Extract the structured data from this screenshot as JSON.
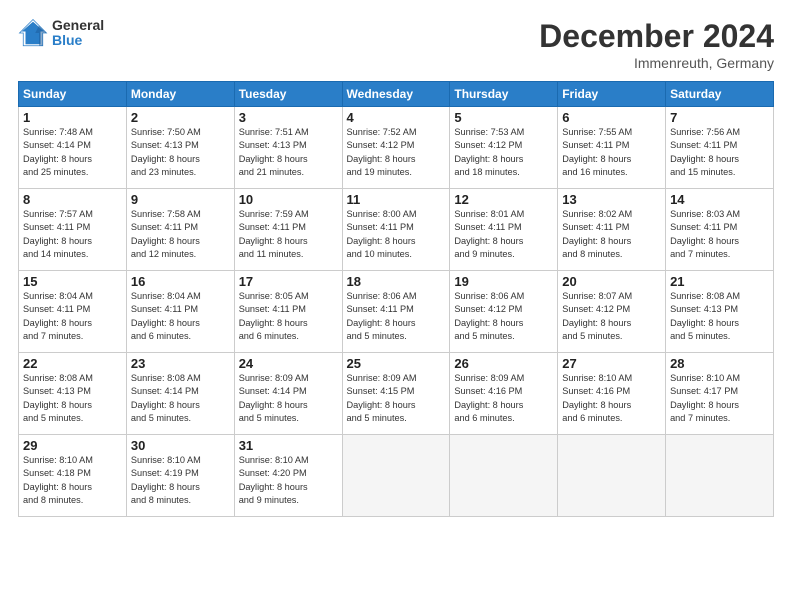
{
  "header": {
    "logo_general": "General",
    "logo_blue": "Blue",
    "month_title": "December 2024",
    "location": "Immenreuth, Germany"
  },
  "weekdays": [
    "Sunday",
    "Monday",
    "Tuesday",
    "Wednesday",
    "Thursday",
    "Friday",
    "Saturday"
  ],
  "weeks": [
    [
      {
        "day": "1",
        "sunrise": "7:48 AM",
        "sunset": "4:14 PM",
        "daylight": "8 hours and 25 minutes."
      },
      {
        "day": "2",
        "sunrise": "7:50 AM",
        "sunset": "4:13 PM",
        "daylight": "8 hours and 23 minutes."
      },
      {
        "day": "3",
        "sunrise": "7:51 AM",
        "sunset": "4:13 PM",
        "daylight": "8 hours and 21 minutes."
      },
      {
        "day": "4",
        "sunrise": "7:52 AM",
        "sunset": "4:12 PM",
        "daylight": "8 hours and 19 minutes."
      },
      {
        "day": "5",
        "sunrise": "7:53 AM",
        "sunset": "4:12 PM",
        "daylight": "8 hours and 18 minutes."
      },
      {
        "day": "6",
        "sunrise": "7:55 AM",
        "sunset": "4:11 PM",
        "daylight": "8 hours and 16 minutes."
      },
      {
        "day": "7",
        "sunrise": "7:56 AM",
        "sunset": "4:11 PM",
        "daylight": "8 hours and 15 minutes."
      }
    ],
    [
      {
        "day": "8",
        "sunrise": "7:57 AM",
        "sunset": "4:11 PM",
        "daylight": "8 hours and 14 minutes."
      },
      {
        "day": "9",
        "sunrise": "7:58 AM",
        "sunset": "4:11 PM",
        "daylight": "8 hours and 12 minutes."
      },
      {
        "day": "10",
        "sunrise": "7:59 AM",
        "sunset": "4:11 PM",
        "daylight": "8 hours and 11 minutes."
      },
      {
        "day": "11",
        "sunrise": "8:00 AM",
        "sunset": "4:11 PM",
        "daylight": "8 hours and 10 minutes."
      },
      {
        "day": "12",
        "sunrise": "8:01 AM",
        "sunset": "4:11 PM",
        "daylight": "8 hours and 9 minutes."
      },
      {
        "day": "13",
        "sunrise": "8:02 AM",
        "sunset": "4:11 PM",
        "daylight": "8 hours and 8 minutes."
      },
      {
        "day": "14",
        "sunrise": "8:03 AM",
        "sunset": "4:11 PM",
        "daylight": "8 hours and 7 minutes."
      }
    ],
    [
      {
        "day": "15",
        "sunrise": "8:04 AM",
        "sunset": "4:11 PM",
        "daylight": "8 hours and 7 minutes."
      },
      {
        "day": "16",
        "sunrise": "8:04 AM",
        "sunset": "4:11 PM",
        "daylight": "8 hours and 6 minutes."
      },
      {
        "day": "17",
        "sunrise": "8:05 AM",
        "sunset": "4:11 PM",
        "daylight": "8 hours and 6 minutes."
      },
      {
        "day": "18",
        "sunrise": "8:06 AM",
        "sunset": "4:11 PM",
        "daylight": "8 hours and 5 minutes."
      },
      {
        "day": "19",
        "sunrise": "8:06 AM",
        "sunset": "4:12 PM",
        "daylight": "8 hours and 5 minutes."
      },
      {
        "day": "20",
        "sunrise": "8:07 AM",
        "sunset": "4:12 PM",
        "daylight": "8 hours and 5 minutes."
      },
      {
        "day": "21",
        "sunrise": "8:08 AM",
        "sunset": "4:13 PM",
        "daylight": "8 hours and 5 minutes."
      }
    ],
    [
      {
        "day": "22",
        "sunrise": "8:08 AM",
        "sunset": "4:13 PM",
        "daylight": "8 hours and 5 minutes."
      },
      {
        "day": "23",
        "sunrise": "8:08 AM",
        "sunset": "4:14 PM",
        "daylight": "8 hours and 5 minutes."
      },
      {
        "day": "24",
        "sunrise": "8:09 AM",
        "sunset": "4:14 PM",
        "daylight": "8 hours and 5 minutes."
      },
      {
        "day": "25",
        "sunrise": "8:09 AM",
        "sunset": "4:15 PM",
        "daylight": "8 hours and 5 minutes."
      },
      {
        "day": "26",
        "sunrise": "8:09 AM",
        "sunset": "4:16 PM",
        "daylight": "8 hours and 6 minutes."
      },
      {
        "day": "27",
        "sunrise": "8:10 AM",
        "sunset": "4:16 PM",
        "daylight": "8 hours and 6 minutes."
      },
      {
        "day": "28",
        "sunrise": "8:10 AM",
        "sunset": "4:17 PM",
        "daylight": "8 hours and 7 minutes."
      }
    ],
    [
      {
        "day": "29",
        "sunrise": "8:10 AM",
        "sunset": "4:18 PM",
        "daylight": "8 hours and 8 minutes."
      },
      {
        "day": "30",
        "sunrise": "8:10 AM",
        "sunset": "4:19 PM",
        "daylight": "8 hours and 8 minutes."
      },
      {
        "day": "31",
        "sunrise": "8:10 AM",
        "sunset": "4:20 PM",
        "daylight": "8 hours and 9 minutes."
      },
      null,
      null,
      null,
      null
    ]
  ]
}
